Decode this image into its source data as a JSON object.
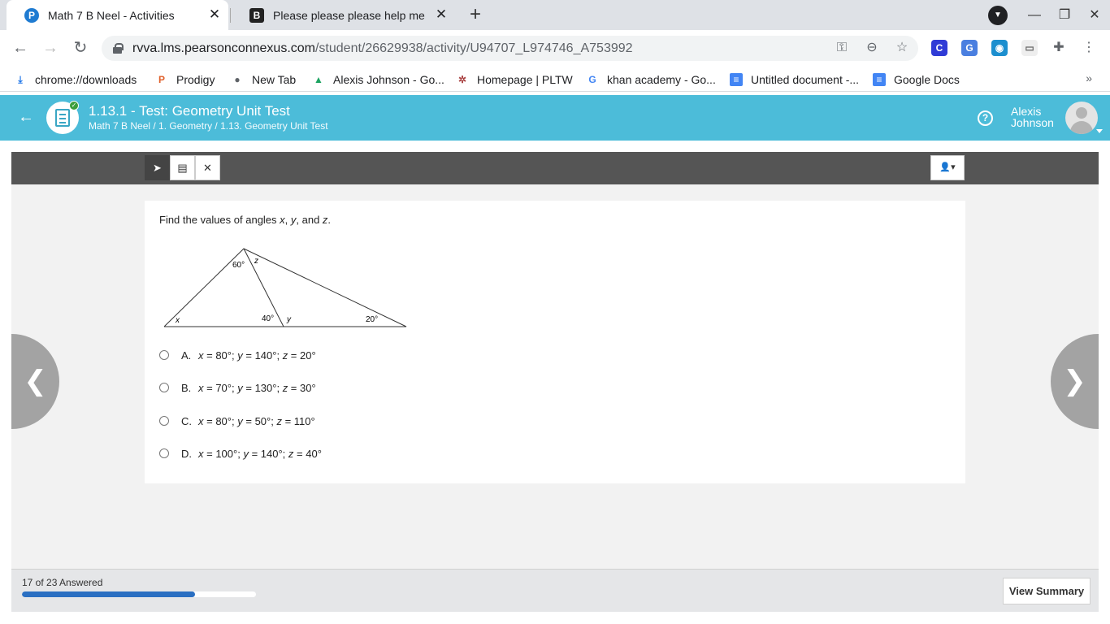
{
  "browser": {
    "tabs": [
      {
        "title": "Math 7 B Neel - Activities",
        "favicon": "P",
        "active": true
      },
      {
        "title": "Please please please help me - B",
        "favicon": "B",
        "active": false
      }
    ],
    "url_host": "rvva.lms.pearsonconnexus.com",
    "url_path": "/student/26629938/activity/U94707_L974746_A753992",
    "bookmarks": [
      {
        "label": "chrome://downloads",
        "icon": "download-icon"
      },
      {
        "label": "Prodigy",
        "icon": "prodigy-icon"
      },
      {
        "label": "New Tab",
        "icon": "globe-icon"
      },
      {
        "label": "Alexis Johnson - Go...",
        "icon": "drive-icon"
      },
      {
        "label": "Homepage | PLTW",
        "icon": "pltw-icon"
      },
      {
        "label": "khan academy - Go...",
        "icon": "google-icon"
      },
      {
        "label": "Untitled document -...",
        "icon": "docs-icon"
      },
      {
        "label": "Google Docs",
        "icon": "docs-icon"
      }
    ],
    "more_label": "»"
  },
  "lms": {
    "title": "1.13.1 - Test: Geometry Unit Test",
    "breadcrumb": "Math 7 B Neel / 1. Geometry / 1.13. Geometry Unit Test",
    "user_first": "Alexis",
    "user_last": "Johnson",
    "help_label": "?"
  },
  "question": {
    "prompt_start": "Find the values of angles ",
    "var_x": "x",
    "sep1": ", ",
    "var_y": "y",
    "sep2": ", and ",
    "var_z": "z",
    "end": ".",
    "figure_labels": {
      "top": "60°",
      "z": "z",
      "x": "x",
      "mid": "40°",
      "y": "y",
      "right": "20°"
    },
    "choices": [
      {
        "letter": "A.",
        "x": "80°",
        "y": "140°",
        "z": "20°"
      },
      {
        "letter": "B.",
        "x": "70°",
        "y": "130°",
        "z": "30°"
      },
      {
        "letter": "C.",
        "x": "80°",
        "y": "50°",
        "z": "110°"
      },
      {
        "letter": "D.",
        "x": "100°",
        "y": "140°",
        "z": "40°"
      }
    ]
  },
  "footer": {
    "answered_text": "17 of 23 Answered",
    "answered": 17,
    "total": 23,
    "summary_label": "View Summary"
  }
}
